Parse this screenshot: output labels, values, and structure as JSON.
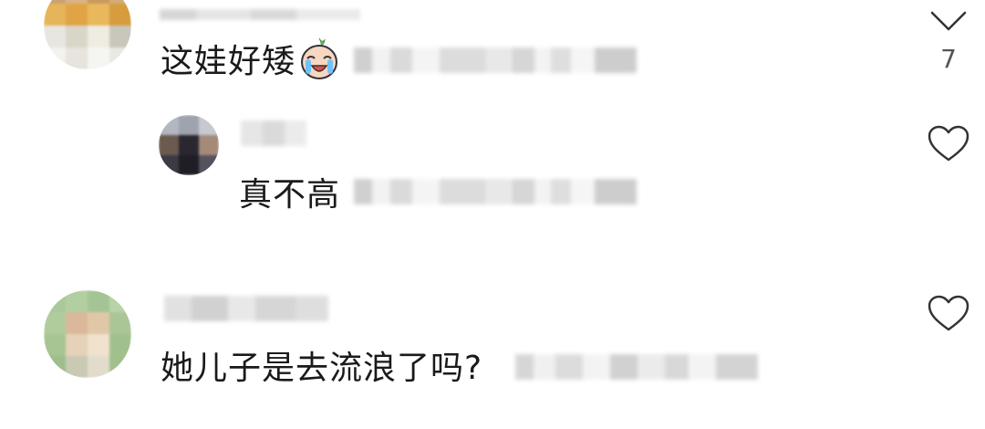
{
  "comments": [
    {
      "text": "这娃好矮",
      "emoji": "crying-face-emoji",
      "expand_count": "7"
    },
    {
      "text": "真不高"
    },
    {
      "text": "她儿子是去流浪了吗?"
    }
  ],
  "colors": {
    "text": "#1a1a1a",
    "icon": "#333333",
    "blur_gray": "#d5d5d5"
  }
}
